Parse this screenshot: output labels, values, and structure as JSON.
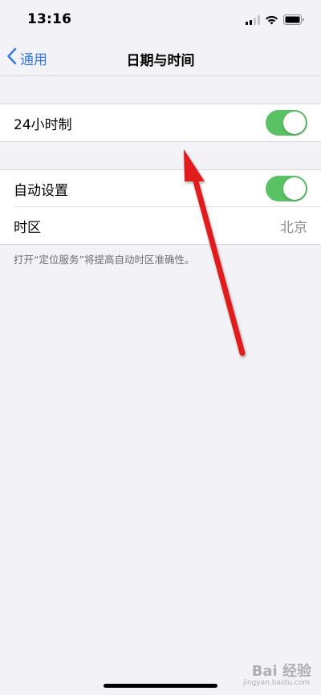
{
  "status_bar": {
    "time": "13:16"
  },
  "nav": {
    "back_label": "通用",
    "title": "日期与时间"
  },
  "group1": {
    "row_24h": {
      "label": "24小时制",
      "toggle_on": true
    }
  },
  "group2": {
    "row_auto": {
      "label": "自动设置",
      "toggle_on": true
    },
    "row_timezone": {
      "label": "时区",
      "value": "北京"
    }
  },
  "footnote": "打开“定位服务”将提高自动时区准确性。",
  "watermark": {
    "brand": "Bai 经验",
    "sub": "jingyan.baidu.com"
  },
  "colors": {
    "accent": "#3a7de0",
    "toggle_on": "#5ac265",
    "annotation_arrow": "#e01e1e",
    "background": "#f2f2f7"
  },
  "icons": {
    "back": "chevron-left-icon",
    "signal": "cellular-signal-icon",
    "wifi": "wifi-icon",
    "battery": "battery-icon"
  }
}
